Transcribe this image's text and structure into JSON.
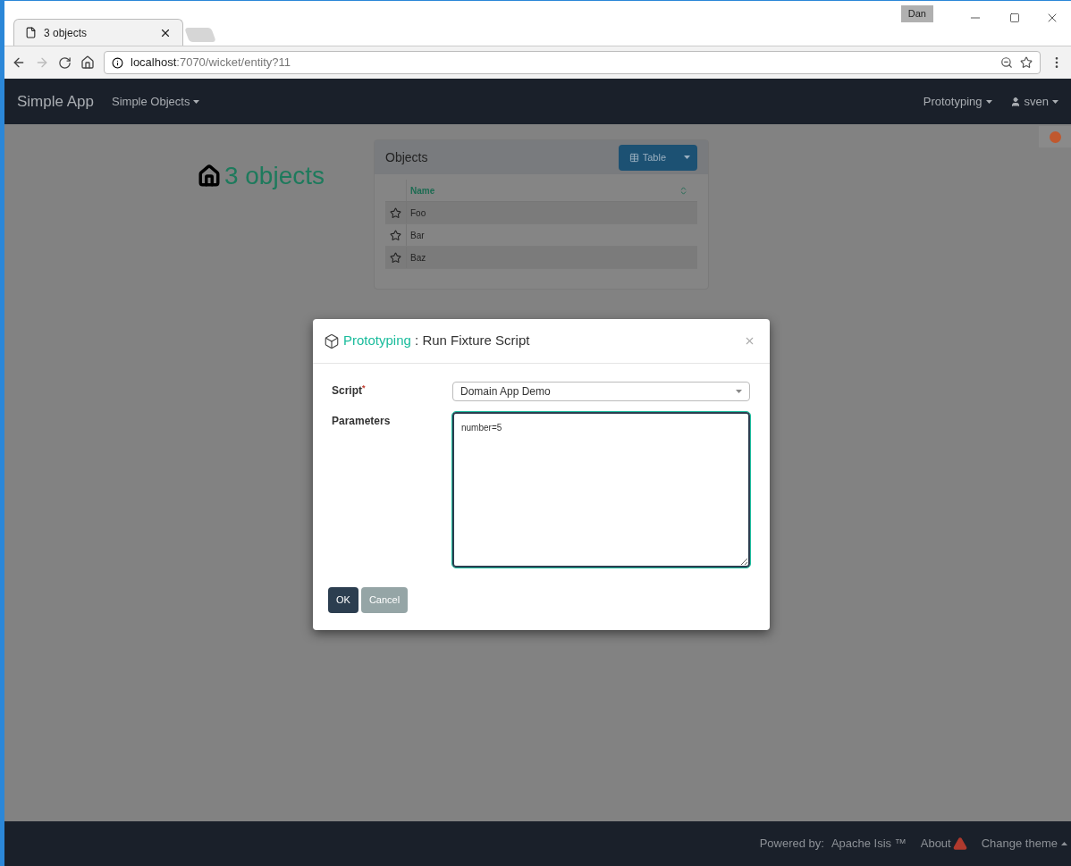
{
  "browser": {
    "tab_title": "3 objects",
    "user_badge": "Dan",
    "url_host": "localhost",
    "url_rest": ":7070/wicket/entity?11"
  },
  "navbar": {
    "brand": "Simple App",
    "menus": [
      {
        "label": "Simple Objects"
      }
    ],
    "right_menus": [
      {
        "label": "Prototyping",
        "kind": "menu"
      },
      {
        "label": "sven",
        "kind": "user"
      }
    ]
  },
  "page": {
    "title": "3 objects",
    "panel": {
      "title": "Objects",
      "view_button": "Table",
      "columns": [
        "Name"
      ],
      "rows": [
        {
          "name": "Foo"
        },
        {
          "name": "Bar"
        },
        {
          "name": "Baz"
        }
      ]
    }
  },
  "dialog": {
    "menu": "Prototyping",
    "title": ": Run Fixture Script",
    "required_marker": "*",
    "fields": [
      {
        "label": "Script",
        "required": true,
        "kind": "select",
        "value": "Domain App Demo"
      },
      {
        "label": "Parameters",
        "required": false,
        "kind": "textarea",
        "value": "number=5"
      }
    ],
    "buttons": [
      {
        "label": "OK",
        "kind": "primary"
      },
      {
        "label": "Cancel",
        "kind": "secondary"
      }
    ]
  },
  "footer": {
    "powered_by": "Powered by:",
    "link": "Apache Isis ™",
    "about": "About",
    "theme": "Change theme"
  }
}
